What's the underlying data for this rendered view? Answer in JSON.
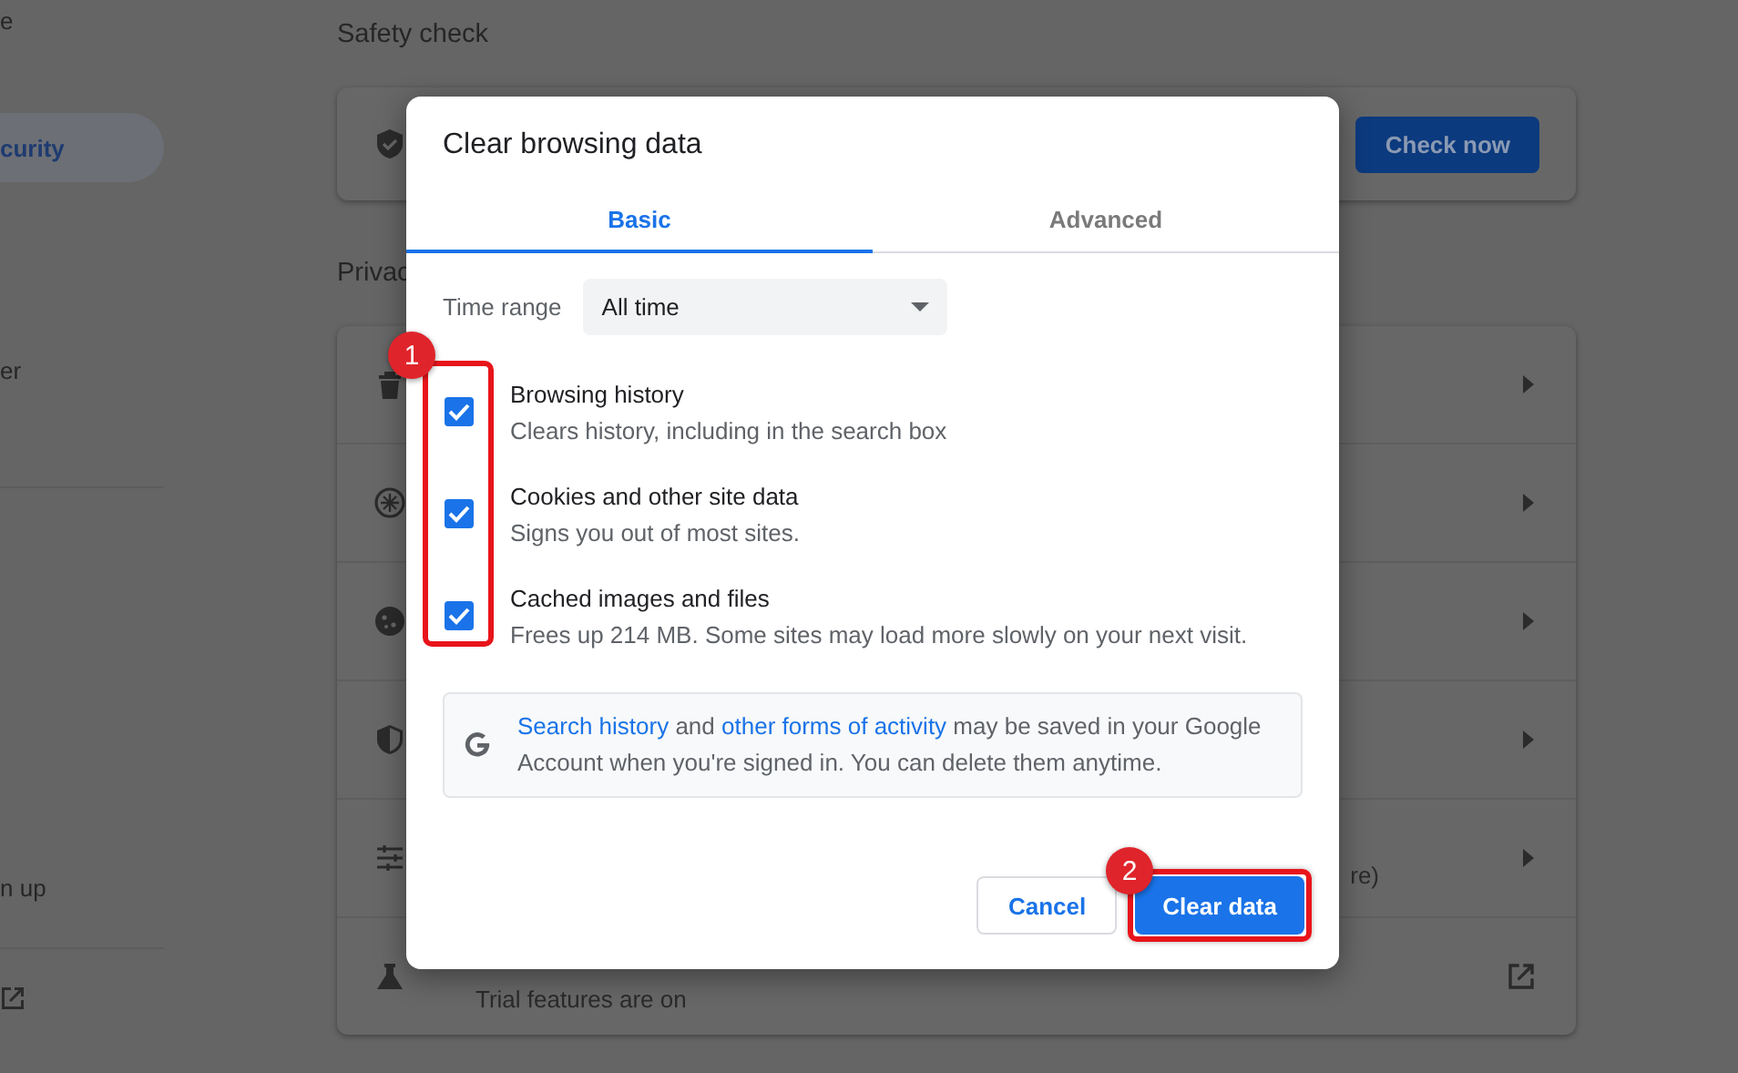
{
  "sidebar": {
    "items": [
      {
        "label": "e",
        "selected": false
      },
      {
        "label": "curity",
        "selected": true
      },
      {
        "label": "er",
        "selected": false
      },
      {
        "label": "n up",
        "selected": false
      }
    ]
  },
  "safety_check": {
    "title": "Safety check",
    "button": "Check now"
  },
  "privacy": {
    "title": "Privac",
    "rows": [
      {
        "kind": "arrow"
      },
      {
        "kind": "arrow"
      },
      {
        "kind": "arrow"
      },
      {
        "kind": "arrow"
      },
      {
        "kind": "arrow",
        "note": "re)"
      },
      {
        "kind": "external",
        "subtitle": "Trial features are on"
      }
    ]
  },
  "dialog": {
    "title": "Clear browsing data",
    "tabs": [
      {
        "label": "Basic",
        "selected": true
      },
      {
        "label": "Advanced",
        "selected": false
      }
    ],
    "time_range": {
      "label": "Time range",
      "value": "All time"
    },
    "options": [
      {
        "title": "Browsing history",
        "description": "Clears history, including in the search box",
        "checked": true
      },
      {
        "title": "Cookies and other site data",
        "description": "Signs you out of most sites.",
        "checked": true
      },
      {
        "title": "Cached images and files",
        "description": "Frees up 214 MB. Some sites may load more slowly on your next visit.",
        "checked": true
      }
    ],
    "info": [
      {
        "kind": "link",
        "text": "Search history"
      },
      {
        "kind": "text",
        "text": " and "
      },
      {
        "kind": "link",
        "text": "other forms of activity"
      },
      {
        "kind": "text",
        "text": " may be saved in your Google Account when you're signed in. You can delete them anytime."
      }
    ],
    "buttons": [
      {
        "label": "Cancel",
        "kind": "secondary"
      },
      {
        "label": "Clear data",
        "kind": "primary"
      }
    ]
  },
  "callouts": [
    {
      "label": "1",
      "kind": "checkboxes"
    },
    {
      "label": "2",
      "kind": "confirm"
    }
  ]
}
